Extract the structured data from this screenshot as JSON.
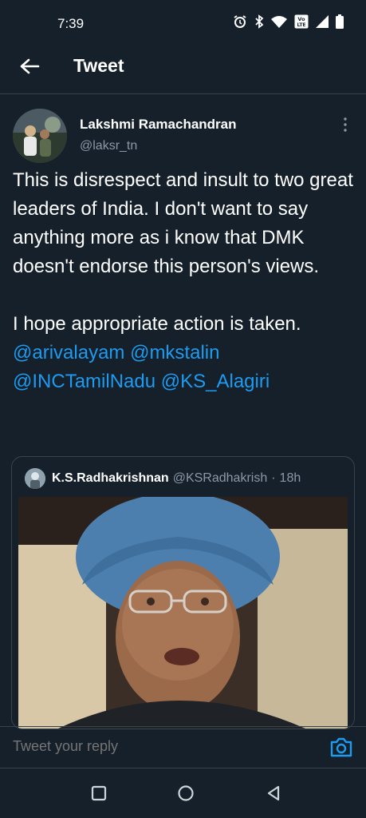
{
  "status_bar": {
    "time": "7:39",
    "icons": [
      "alarm-icon",
      "bluetooth-icon",
      "wifi-icon",
      "volte-icon",
      "signal-icon",
      "battery-icon"
    ],
    "volte_label": "Vo LTE"
  },
  "header": {
    "title": "Tweet",
    "back_icon": "arrow-left-icon"
  },
  "tweet": {
    "author_name": "Lakshmi Ramachandran",
    "author_handle": "@laksr_tn",
    "paragraph1": "This is disrespect and insult to two great leaders of India. I don't want to say anything more as i know that DMK doesn't endorse this person's views.",
    "paragraph2": "I hope appropriate action is taken.",
    "mentions": [
      "@arivalayam",
      "@mkstalin",
      "@INCTamilNadu",
      "@KS_Alagiri"
    ]
  },
  "quoted_tweet": {
    "name": "K.S.Radhakrishnan",
    "handle": "@KSRadhakrish",
    "separator": "·",
    "time": "18h"
  },
  "reply": {
    "placeholder": "Tweet your reply",
    "camera_icon": "camera-icon"
  },
  "nav": {
    "icons": [
      "recents-icon",
      "home-icon",
      "back-icon"
    ]
  },
  "colors": {
    "background": "#15202b",
    "accent": "#1d9bf0",
    "border": "#38444d",
    "secondary_text": "#8b98a5"
  }
}
